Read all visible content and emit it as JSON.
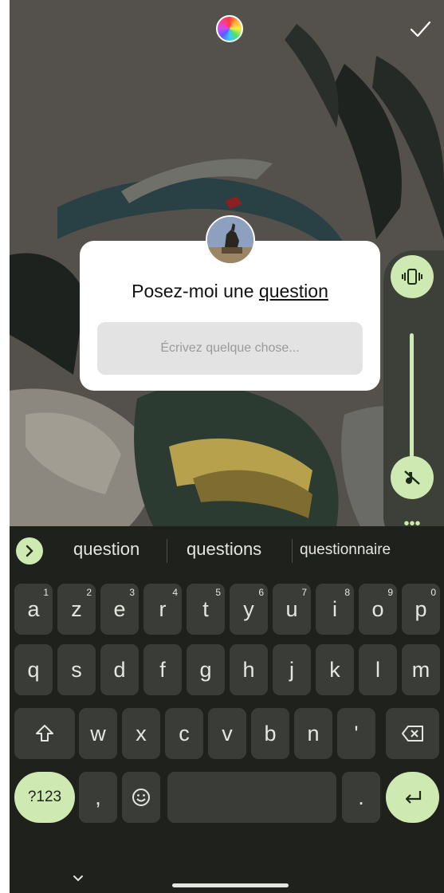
{
  "story": {
    "sticker": {
      "title_prefix": "Posez-moi une ",
      "title_emphasis": "question",
      "input_placeholder": "Écrivez quelque chose..."
    }
  },
  "icons": {
    "color_picker": "color-wheel-icon",
    "done": "checkmark-icon",
    "vibrate": "vibrate-icon",
    "mute": "notifications-off-icon",
    "captions": "live-caption-off-icon"
  },
  "volume": {
    "more_label": "•••"
  },
  "keyboard": {
    "suggestions": [
      "question",
      "questions",
      "questionnaire"
    ],
    "rows": [
      [
        {
          "k": "a",
          "n": "1"
        },
        {
          "k": "z",
          "n": "2"
        },
        {
          "k": "e",
          "n": "3"
        },
        {
          "k": "r",
          "n": "4"
        },
        {
          "k": "t",
          "n": "5"
        },
        {
          "k": "y",
          "n": "6"
        },
        {
          "k": "u",
          "n": "7"
        },
        {
          "k": "i",
          "n": "8"
        },
        {
          "k": "o",
          "n": "9"
        },
        {
          "k": "p",
          "n": "0"
        }
      ],
      [
        {
          "k": "q"
        },
        {
          "k": "s"
        },
        {
          "k": "d"
        },
        {
          "k": "f"
        },
        {
          "k": "g"
        },
        {
          "k": "h"
        },
        {
          "k": "j"
        },
        {
          "k": "k"
        },
        {
          "k": "l"
        },
        {
          "k": "m"
        }
      ],
      [
        {
          "k": "w"
        },
        {
          "k": "x"
        },
        {
          "k": "c"
        },
        {
          "k": "v"
        },
        {
          "k": "b"
        },
        {
          "k": "n"
        },
        {
          "k": "'"
        }
      ]
    ],
    "symbols_label": "?123",
    "comma_label": ",",
    "period_label": ".",
    "accent_color": "#cfe9b2"
  }
}
